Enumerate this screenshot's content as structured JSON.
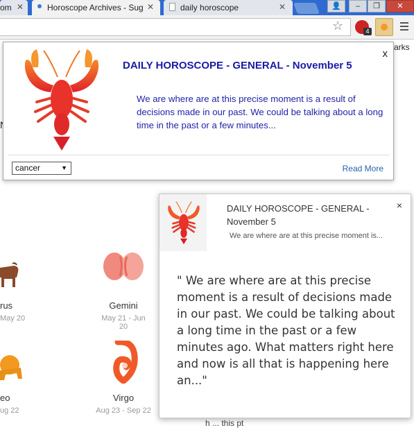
{
  "tabs": [
    {
      "title": "om"
    },
    {
      "title": "Horoscope Archives - Sug"
    },
    {
      "title": "daily horoscope"
    }
  ],
  "toolbar": {
    "extension_badge": "4",
    "bookmarks_label": "arks"
  },
  "page": {
    "sidebar_letter": "N",
    "signs": [
      {
        "name": "rus",
        "date": "May 20"
      },
      {
        "name": "Gemini",
        "date": "May 21 - Jun 20"
      },
      {
        "name": "eo",
        "date": "ug 22"
      },
      {
        "name": "Virgo",
        "date": "Aug 23 - Sep 22"
      }
    ],
    "bottom_text": "h   ...    this pt"
  },
  "popup": {
    "close": "x",
    "title": "DAILY HOROSCOPE - GENERAL - November 5",
    "text": "We are where are at this precise moment is a result of decisions made in our past. We could be talking about a long time in the past or a few minutes...",
    "selected_sign": "cancer",
    "read_more": "Read More"
  },
  "notification": {
    "close": "×",
    "title": "DAILY HOROSCOPE - GENERAL - November 5",
    "snippet": "We are where are at this precise moment is...",
    "body": "\" We are where are at this precise moment is a result of decisions made in our past. We could be talking about a long time in the past or a few minutes ago. What matters right here and now is all that is happening here an...\""
  },
  "colors": {
    "title_blue": "#1a1aa6",
    "text_blue": "#2222aa",
    "link": "#2a5db0",
    "lobster": "#e8322a",
    "chrome_blue": "#2e6ad0"
  }
}
